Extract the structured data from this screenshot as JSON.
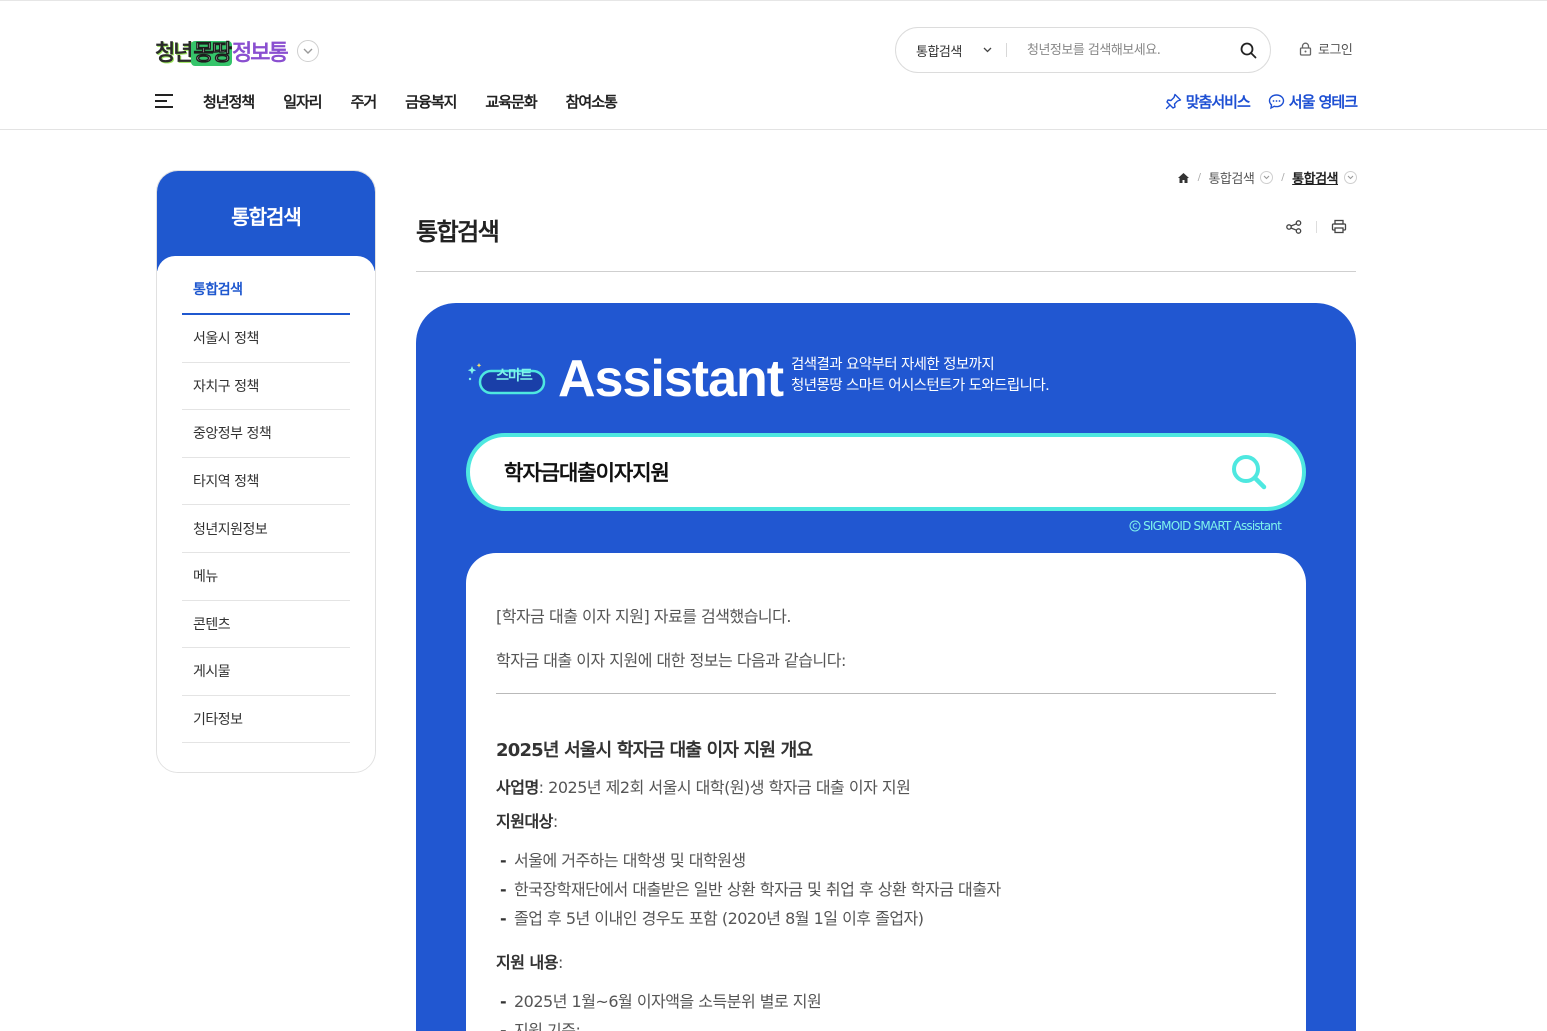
{
  "header": {
    "logo": {
      "part1": "청년",
      "part2": "몽땅",
      "part3": "정보통"
    },
    "search": {
      "select_label": "통합검색",
      "placeholder": "청년정보를 검색해보세요."
    },
    "login_label": "로그인",
    "gnb": [
      "청년정책",
      "일자리",
      "주거",
      "금융복지",
      "교육문화",
      "참여소통"
    ],
    "quick": {
      "custom_service": "맞춤서비스",
      "seoul_youngtalk": "서울 영테크"
    }
  },
  "sidebar": {
    "title": "통합검색",
    "items": [
      "통합검색",
      "서울시 정책",
      "자치구 정책",
      "중앙정부 정책",
      "타지역 정책",
      "청년지원정보",
      "메뉴",
      "콘텐츠",
      "게시물",
      "기타정보"
    ]
  },
  "breadcrumb": {
    "level1": "통합검색",
    "level2": "통합검색"
  },
  "page_title": "통합검색",
  "assistant": {
    "badge": "스마트",
    "word": "Assistant",
    "desc_line1": "검색결과 요약부터 자세한 정보까지",
    "desc_line2": "청년몽땅 스마트 어시스턴트가 도와드립니다.",
    "query": "학자금대출이자지원",
    "credit": "SIGMOID SMART Assistant"
  },
  "result": {
    "line1": "[학자금 대출 이자 지원] 자료를 검색했습니다.",
    "line2": "학자금 대출 이자 지원에 대한 정보는 다음과 같습니다:",
    "heading": "2025년 서울시 학자금 대출 이자 지원 개요",
    "project_label": "사업명",
    "project_value": ": 2025년 제2회 서울시 대학(원)생 학자금 대출 이자 지원",
    "target_label": "지원대상",
    "target_suffix": ":",
    "target_items": [
      "서울에 거주하는 대학생 및 대학원생",
      "한국장학재단에서 대출받은 일반 상환 학자금 및 취업 후 상환 학자금 대출자",
      "졸업 후 5년 이내인 경우도 포함 (2020년 8월 1일 이후 졸업자)"
    ],
    "content_label": "지원 내용",
    "content_suffix": ":",
    "content_items": [
      "2025년 1월~6월 이자액을 소득분위 별로 지원",
      "지원 기준:"
    ],
    "dash": "-"
  },
  "colors": {
    "primary": "#1f58cf",
    "panel": "#2157d1",
    "accent_cyan": "#4ee8e0"
  }
}
